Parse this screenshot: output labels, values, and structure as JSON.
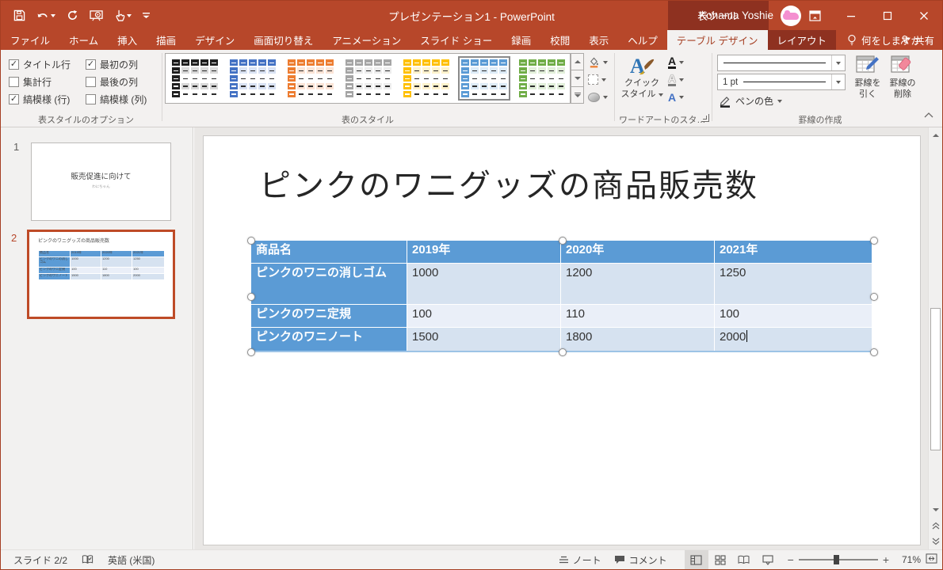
{
  "titlebar": {
    "title": "プレゼンテーション1  -  PowerPoint",
    "context_group": "表ツール",
    "user_name": "Kohama Yoshie",
    "qat_icons": [
      "save-icon",
      "undo-icon",
      "repeat-icon",
      "start-slideshow-icon",
      "touch-mode-icon",
      "customize-qat-icon"
    ]
  },
  "tabs": [
    {
      "label": "ファイル",
      "state": "normal"
    },
    {
      "label": "ホーム",
      "state": "normal"
    },
    {
      "label": "挿入",
      "state": "normal"
    },
    {
      "label": "描画",
      "state": "normal"
    },
    {
      "label": "デザイン",
      "state": "normal"
    },
    {
      "label": "画面切り替え",
      "state": "normal"
    },
    {
      "label": "アニメーション",
      "state": "normal"
    },
    {
      "label": "スライド ショー",
      "state": "normal"
    },
    {
      "label": "録画",
      "state": "normal"
    },
    {
      "label": "校閲",
      "state": "normal"
    },
    {
      "label": "表示",
      "state": "normal"
    },
    {
      "label": "ヘルプ",
      "state": "normal"
    },
    {
      "label": "テーブル デザイン",
      "state": "active"
    },
    {
      "label": "レイアウト",
      "state": "contextual"
    }
  ],
  "tellme_label": "何をしますか",
  "share_label": "共有",
  "ribbon": {
    "options_group": {
      "label": "表スタイルのオプション",
      "items": [
        {
          "label": "タイトル行",
          "checked": true
        },
        {
          "label": "最初の列",
          "checked": true
        },
        {
          "label": "集計行",
          "checked": false
        },
        {
          "label": "最後の列",
          "checked": false
        },
        {
          "label": "縞模様 (行)",
          "checked": true
        },
        {
          "label": "縞模様 (列)",
          "checked": false
        }
      ]
    },
    "styles_group": {
      "label": "表のスタイル",
      "styles": [
        {
          "name": "dark-style",
          "color": "#1F1F1F",
          "tint": "#D9D9D9",
          "selected": false
        },
        {
          "name": "medium-style-blue",
          "color": "#4472C4",
          "tint": "#D9E2F3",
          "selected": false
        },
        {
          "name": "medium-style-orange",
          "color": "#ED7D31",
          "tint": "#FCE4D6",
          "selected": false
        },
        {
          "name": "medium-style-gray",
          "color": "#A5A5A5",
          "tint": "#EDEDED",
          "selected": false
        },
        {
          "name": "medium-style-gold",
          "color": "#FFC000",
          "tint": "#FFF2CC",
          "selected": false
        },
        {
          "name": "medium-style-accent1",
          "color": "#5B9BD5",
          "tint": "#DDEBF7",
          "selected": true
        },
        {
          "name": "medium-style-green",
          "color": "#70AD47",
          "tint": "#E2EFDA",
          "selected": false
        }
      ]
    },
    "wordart_group": {
      "label": "ワードアートのスタ…",
      "quick_style_line1": "クイック",
      "quick_style_line2": "スタイル"
    },
    "borders_group": {
      "label": "罫線の作成",
      "pen_weight": "1 pt",
      "pen_color_label": "ペンの色",
      "draw_line1": "罫線を",
      "draw_line2": "引く",
      "erase_line1": "罫線の",
      "erase_line2": "削除"
    }
  },
  "panel": {
    "slides": [
      {
        "number": "1",
        "selected": false
      },
      {
        "number": "2",
        "selected": true
      }
    ],
    "slide1": {
      "title": "販売促進に向けて",
      "subtitle": "わにちゃん"
    }
  },
  "slide": {
    "title": "ピンクのワニグッズの商品販売数",
    "table": {
      "headers": [
        "商品名",
        "2019年",
        "2020年",
        "2021年"
      ],
      "rows": [
        [
          "ピンクのワニの消しゴム",
          "1000",
          "1200",
          "1250"
        ],
        [
          "ピンクのワニ定規",
          "100",
          "110",
          "100"
        ],
        [
          "ピンクのワニノート",
          "1500",
          "1800",
          "2000"
        ]
      ],
      "cursor_cell": {
        "row": 2,
        "col": 3
      },
      "colors": {
        "header": "#5B9BD5",
        "band_odd": "#D6E2F0",
        "band_even": "#EAEFF8"
      }
    }
  },
  "statusbar": {
    "slide_indicator": "スライド 2/2",
    "language": "英語 (米国)",
    "notes_label": "ノート",
    "comments_label": "コメント",
    "zoom_level": "71%"
  },
  "colors": {
    "titlebar": "#B7472A",
    "contextual_tab": "#8E3120",
    "ribbon_bg": "#F3F1F0",
    "selection_border": "#BE4B27",
    "table_header": "#5B9BD5"
  }
}
